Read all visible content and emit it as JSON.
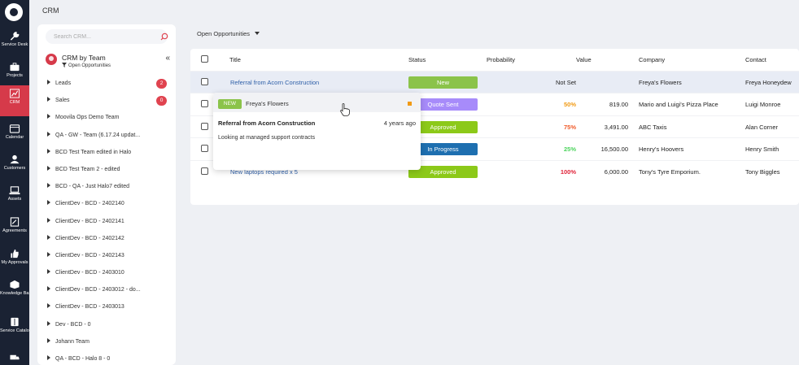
{
  "header": {
    "title": "CRM"
  },
  "nav": [
    {
      "label": "Service Desk",
      "icon": "wrench-icon"
    },
    {
      "label": "Projects",
      "icon": "briefcase-icon"
    },
    {
      "label": "CRM",
      "icon": "chart-icon",
      "active": true
    },
    {
      "label": "Calendar",
      "icon": "calendar-icon"
    },
    {
      "label": "Customers",
      "icon": "person-icon"
    },
    {
      "label": "Assets",
      "icon": "laptop-icon"
    },
    {
      "label": "Agreements",
      "icon": "document-icon"
    },
    {
      "label": "My Approvals",
      "icon": "thumbs-up-icon"
    },
    {
      "label": "Knowledge Base",
      "icon": "box-icon"
    },
    {
      "label": "Service Catalogue",
      "icon": "book-icon"
    },
    {
      "label": "",
      "icon": "truck-icon"
    }
  ],
  "sidebar": {
    "search_placeholder": "Search CRM...",
    "title": "CRM by Team",
    "subtitle": "Open Opportunities",
    "items": [
      {
        "label": "Leads",
        "count": "2"
      },
      {
        "label": "Sales",
        "count": "0"
      },
      {
        "label": "Moovila Ops Demo Team"
      },
      {
        "label": "QA - GW - Team (6.17.24 updat..."
      },
      {
        "label": "BCD Test Team edited in Halo"
      },
      {
        "label": "BCD Test Team 2 - edited"
      },
      {
        "label": "BCD - QA - Just Halo7 edited"
      },
      {
        "label": "ClientDev - BCD - 2402140"
      },
      {
        "label": "ClientDev - BCD - 2402141"
      },
      {
        "label": "ClientDev - BCD - 2402142"
      },
      {
        "label": "ClientDev - BCD - 2402143"
      },
      {
        "label": "ClientDev - BCD - 2403010"
      },
      {
        "label": "ClientDev - BCD - 2403012 - do..."
      },
      {
        "label": "ClientDev - BCD - 2403013"
      },
      {
        "label": "Dev - BCD - 0"
      },
      {
        "label": "Johann Team"
      },
      {
        "label": "QA - BCD - Halo 8 - 0"
      }
    ]
  },
  "main": {
    "view_label": "Open Opportunities",
    "columns": [
      "Title",
      "Status",
      "Probability",
      "Value",
      "Company",
      "Contact"
    ],
    "rows": [
      {
        "title": "Referral from Acorn Construction",
        "status": "New",
        "status_color": "#8bc34a",
        "probability": "Not Set",
        "prob_color": "#222222",
        "value": "",
        "company": "Freya's Flowers",
        "contact": "Freya Honeydew"
      },
      {
        "title": "",
        "status": "Quote Sent",
        "status_color": "#a78bfa",
        "probability": "50%",
        "prob_color": "#f19a14",
        "value": "819.00",
        "company": "Mario and Luigi's Pizza Place",
        "contact": "Luigi Monroe"
      },
      {
        "title": "",
        "status": "Approved",
        "status_color": "#8cc919",
        "probability": "75%",
        "prob_color": "#f05a28",
        "value": "3,491.00",
        "company": "ABC Taxis",
        "contact": "Alan Corner"
      },
      {
        "title": "",
        "status": "In Progress",
        "status_color": "#1e6fb0",
        "probability": "25%",
        "prob_color": "#4bd45c",
        "value": "16,500.00",
        "company": "Henry's Hoovers",
        "contact": "Henry Smith"
      },
      {
        "title": "New laptops required x 5",
        "status": "Approved",
        "status_color": "#8cc919",
        "probability": "100%",
        "prob_color": "#e0243a",
        "value": "6,000.00",
        "company": "Tony's Tyre Emporium.",
        "contact": "Tony Biggles"
      }
    ]
  },
  "popup": {
    "badge": "NEW",
    "badge_color": "#8bc34a",
    "company": "Freya's Flowers",
    "title": "Referral from Acorn Construction",
    "age": "4 years ago",
    "description": "Looking at managed support contracts"
  }
}
